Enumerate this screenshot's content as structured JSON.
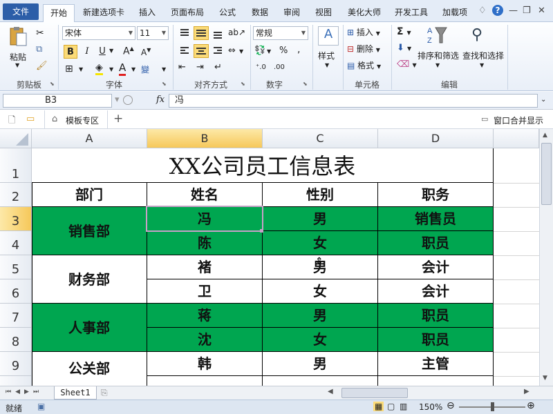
{
  "tabs": [
    "文件",
    "开始",
    "新建选项卡",
    "插入",
    "页面布局",
    "公式",
    "数据",
    "审阅",
    "视图",
    "美化大师",
    "开发工具",
    "加载项"
  ],
  "ribbon": {
    "paste_label": "粘贴",
    "clipboard_label": "剪贴板",
    "font_name": "宋体",
    "font_size": "11",
    "bold": "B",
    "italic": "I",
    "underline": "U",
    "font_group_label": "字体",
    "align_group_label": "对齐方式",
    "number_format": "常规",
    "number_group_label": "数字",
    "styles_label": "样式",
    "insert_label": "插入",
    "delete_label": "删除",
    "format_label": "格式",
    "cells_group_label": "单元格",
    "sort_filter_label": "排序和筛选",
    "find_select_label": "查找和选择",
    "editing_group_label": "编辑"
  },
  "formula_bar": {
    "name_box": "B3",
    "fx": "fx",
    "content": "冯"
  },
  "workbook_bar": {
    "template_zone": "模板专区",
    "add": "+",
    "merge_window": "窗口合并显示"
  },
  "grid": {
    "columns": [
      "A",
      "B",
      "C",
      "D"
    ],
    "rows": [
      "1",
      "2",
      "3",
      "4",
      "5",
      "6",
      "7",
      "8",
      "9"
    ],
    "title": "XX公司员工信息表",
    "headers": [
      "部门",
      "姓名",
      "性别",
      "职务"
    ],
    "departments": [
      "销售部",
      "财务部",
      "人事部",
      "公关部"
    ],
    "data": [
      {
        "name": "冯",
        "gender": "男",
        "role": "销售员"
      },
      {
        "name": "陈",
        "gender": "女",
        "role": "职员"
      },
      {
        "name": "褚",
        "gender": "男",
        "role": "会计"
      },
      {
        "name": "卫",
        "gender": "女",
        "role": "会计"
      },
      {
        "name": "蒋",
        "gender": "男",
        "role": "职员"
      },
      {
        "name": "沈",
        "gender": "女",
        "role": "职员"
      },
      {
        "name": "韩",
        "gender": "男",
        "role": "主管"
      }
    ],
    "green": "#00a650",
    "selected_cell": "B3"
  },
  "sheet_tab": "Sheet1",
  "status": {
    "ready": "就绪",
    "zoom": "150%"
  }
}
